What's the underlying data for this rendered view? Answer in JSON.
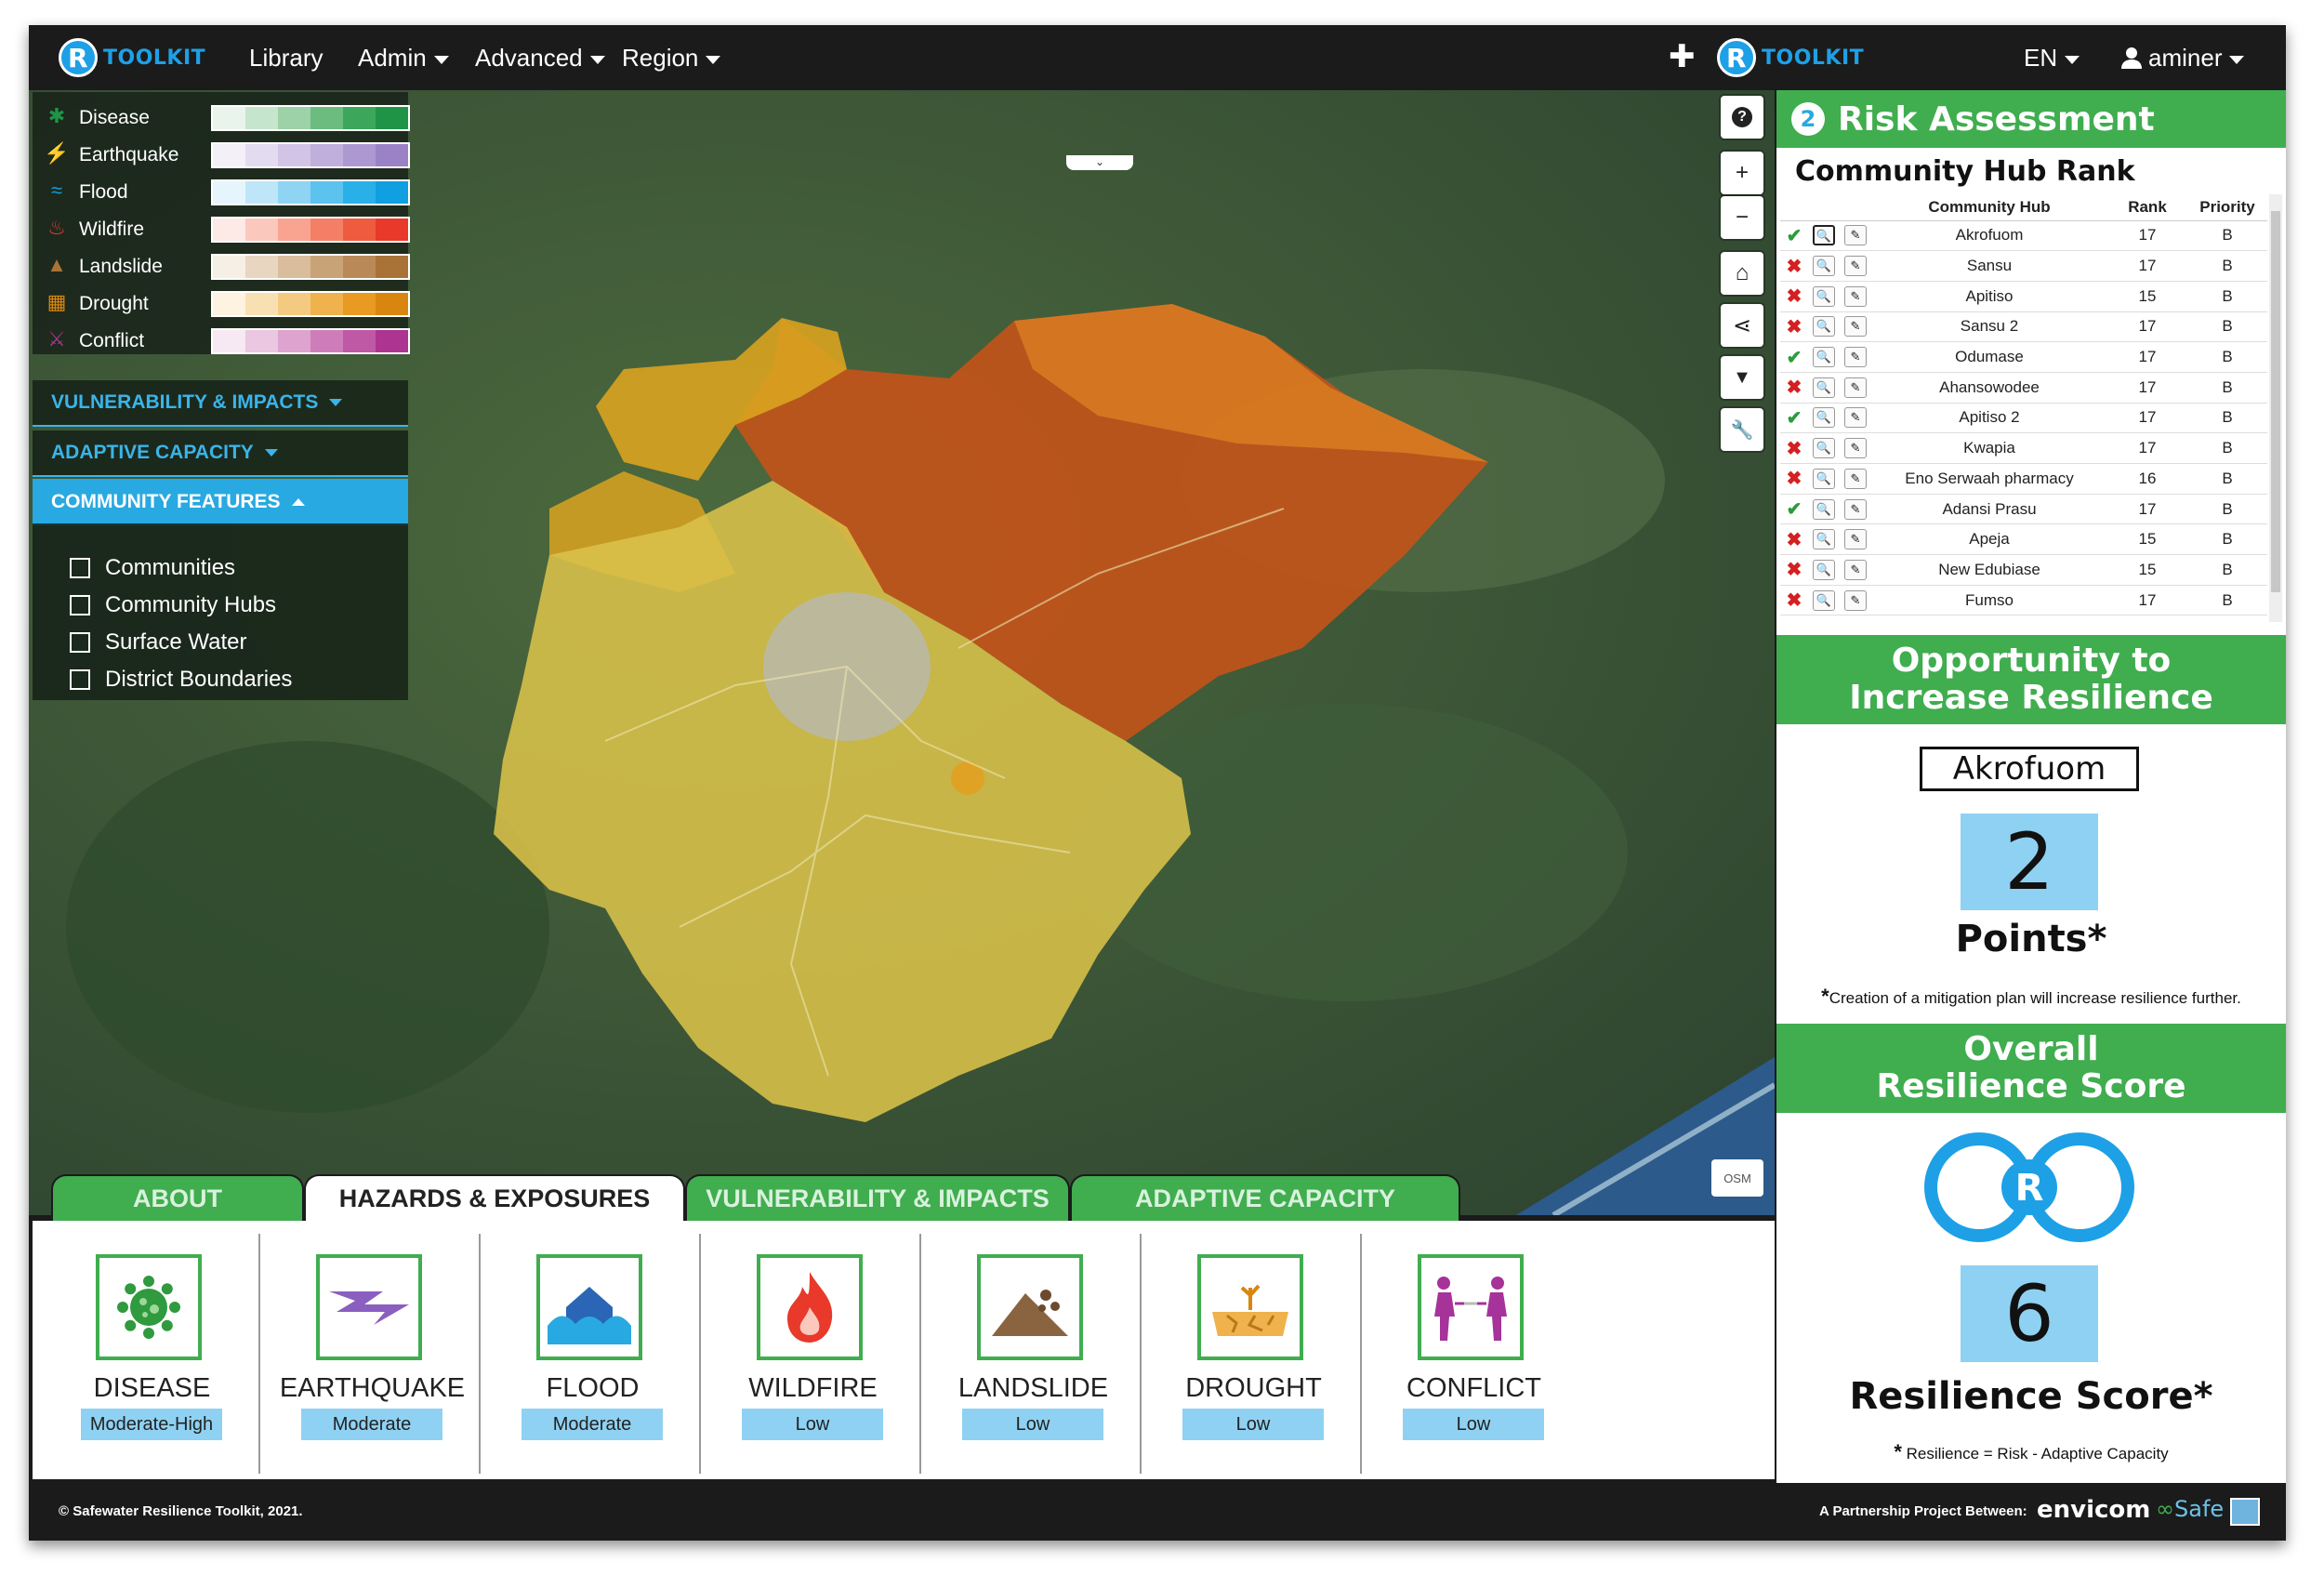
{
  "nav": {
    "brand_left": "TOOLKIT",
    "brand_right": "TOOLKIT",
    "brand_letter": "R",
    "items": [
      "Library",
      "Admin",
      "Advanced",
      "Region"
    ],
    "plus": "✚",
    "language": "EN",
    "user": "aminer"
  },
  "legend": {
    "items": [
      {
        "label": "Disease",
        "icon": "virus-icon",
        "glyph": "✱",
        "colors": [
          "#e9f4ec",
          "#c6e5cd",
          "#9dd2a8",
          "#6cbc7f",
          "#3ca75a",
          "#1f9447"
        ]
      },
      {
        "label": "Earthquake",
        "icon": "lightning-icon",
        "glyph": "⚡",
        "colors": [
          "#f4f0f8",
          "#e3dbef",
          "#d2c4e6",
          "#c0aedc",
          "#ae98d2",
          "#9b82c7"
        ]
      },
      {
        "label": "Flood",
        "icon": "wave-icon",
        "glyph": "≈",
        "colors": [
          "#e6f5fc",
          "#bfe6f8",
          "#8fd4f3",
          "#5cc2ee",
          "#2ab0e8",
          "#109fe0"
        ]
      },
      {
        "label": "Wildfire",
        "icon": "fire-icon",
        "glyph": "♨",
        "colors": [
          "#fde9e5",
          "#fbc8bd",
          "#f8a491",
          "#f47f66",
          "#ef5b3e",
          "#e8392a"
        ]
      },
      {
        "label": "Landslide",
        "icon": "mountain-icon",
        "glyph": "▲",
        "colors": [
          "#f6efe6",
          "#e8d6c1",
          "#d9bd9c",
          "#c9a378",
          "#b98a57",
          "#a97338"
        ]
      },
      {
        "label": "Drought",
        "icon": "cracked-earth-icon",
        "glyph": "▦",
        "colors": [
          "#fdf3e0",
          "#f9e0b3",
          "#f4ca80",
          "#efb24d",
          "#e89a22",
          "#d98610"
        ]
      },
      {
        "label": "Conflict",
        "icon": "tug-of-war-icon",
        "glyph": "⚔",
        "colors": [
          "#f7e9f3",
          "#ebc7e1",
          "#dea3ce",
          "#cf7dba",
          "#bf58a5",
          "#ad3491"
        ]
      }
    ]
  },
  "sections": {
    "vulnerability": "VULNERABILITY & IMPACTS",
    "adaptive": "ADAPTIVE CAPACITY",
    "community": "COMMUNITY FEATURES"
  },
  "features": [
    "Communities",
    "Community Hubs",
    "Surface Water",
    "District Boundaries"
  ],
  "map": {
    "controls": [
      "?",
      "+",
      "−",
      "⌂",
      "⋖",
      "▼",
      "🔧"
    ],
    "osm": "OSM",
    "toggle": "⌄"
  },
  "tabs": [
    "ABOUT",
    "HAZARDS & EXPOSURES",
    "VULNERABILITY & IMPACTS",
    "ADAPTIVE CAPACITY"
  ],
  "hazards": [
    {
      "name": "DISEASE",
      "level": "Moderate-High",
      "icon": "virus-icon"
    },
    {
      "name": "EARTHQUAKE",
      "level": "Moderate",
      "icon": "lightning-icon"
    },
    {
      "name": "FLOOD",
      "level": "Moderate",
      "icon": "flood-house-icon"
    },
    {
      "name": "WILDFIRE",
      "level": "Low",
      "icon": "fire-icon"
    },
    {
      "name": "LANDSLIDE",
      "level": "Low",
      "icon": "landslide-icon"
    },
    {
      "name": "DROUGHT",
      "level": "Low",
      "icon": "drought-icon"
    },
    {
      "name": "CONFLICT",
      "level": "Low",
      "icon": "tug-of-war-icon"
    }
  ],
  "risk": {
    "step": "2",
    "title": "Risk Assessment",
    "subtitle": "Community Hub Rank",
    "columns": [
      "Community Hub",
      "Rank",
      "Priority"
    ],
    "rows": [
      {
        "ok": true,
        "hub": "Akrofuom",
        "rank": "17",
        "priority": "B"
      },
      {
        "ok": false,
        "hub": "Sansu",
        "rank": "17",
        "priority": "B"
      },
      {
        "ok": false,
        "hub": "Apitiso",
        "rank": "15",
        "priority": "B"
      },
      {
        "ok": false,
        "hub": "Sansu 2",
        "rank": "17",
        "priority": "B"
      },
      {
        "ok": true,
        "hub": "Odumase",
        "rank": "17",
        "priority": "B"
      },
      {
        "ok": false,
        "hub": "Ahansowodee",
        "rank": "17",
        "priority": "B"
      },
      {
        "ok": true,
        "hub": "Apitiso 2",
        "rank": "17",
        "priority": "B"
      },
      {
        "ok": false,
        "hub": "Kwapia",
        "rank": "17",
        "priority": "B"
      },
      {
        "ok": false,
        "hub": "Eno Serwaah pharmacy",
        "rank": "16",
        "priority": "B"
      },
      {
        "ok": true,
        "hub": "Adansi Prasu",
        "rank": "17",
        "priority": "B"
      },
      {
        "ok": false,
        "hub": "Apeja",
        "rank": "15",
        "priority": "B"
      },
      {
        "ok": false,
        "hub": "New Edubiase",
        "rank": "15",
        "priority": "B"
      },
      {
        "ok": false,
        "hub": "Fumso",
        "rank": "17",
        "priority": "B"
      }
    ]
  },
  "opportunity": {
    "title_line1": "Opportunity to",
    "title_line2": "Increase Resilience",
    "hub": "Akrofuom",
    "points": "2",
    "points_label": "Points*",
    "note": "Creation of a mitigation plan will increase resilience further.",
    "note_star": "*"
  },
  "overall": {
    "title_line1": "Overall",
    "title_line2": "Resilience Score",
    "score": "6",
    "score_label": "Resilience Score*",
    "formula_star": "*",
    "formula": "Resilience = Risk - Adaptive Capacity"
  },
  "footer": {
    "copyright": "© Safewater Resilience Toolkit, 2021.",
    "partnership": "A Partnership Project Between:",
    "partner1": "envicom",
    "partner2": "Safe"
  },
  "colors": {
    "green": "#40ad4f",
    "blue": "#29a9e1",
    "score_bg": "#8fd1f2",
    "dark": "#1b1b1b"
  }
}
